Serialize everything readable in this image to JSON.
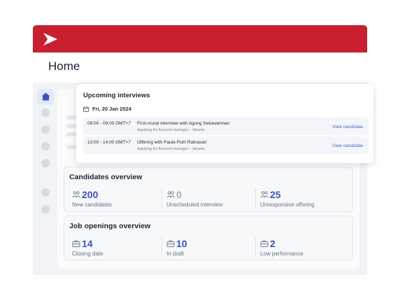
{
  "brand": {
    "bar_color": "#c8202f",
    "logo_icon": "chevron-logo"
  },
  "page": {
    "title": "Home"
  },
  "sidebar": {
    "active_icon": "home-icon",
    "accent": "#3b55b8"
  },
  "upcoming": {
    "title": "Upcoming interviews",
    "date": "Fri, 20 Jan 2024",
    "items": [
      {
        "time": "08:00 - 09:00 GMT+7",
        "title": "First-round interview with Agung Setiawarman",
        "subtitle": "Applying for Account manager - Jakarta",
        "link": "View candidate"
      },
      {
        "time": "13:00 - 14:00 GMT+7",
        "title": "Offering with Paula Putri Ratnasari",
        "subtitle": "Applying for Account manager - Jakarta",
        "link": "View candidate"
      }
    ]
  },
  "candidates": {
    "title": "Candidates overview",
    "stats": [
      {
        "value": "200",
        "label": "New candidates",
        "icon": "people-icon"
      },
      {
        "value": "0",
        "label": "Unscheduled interview",
        "icon": "people-icon"
      },
      {
        "value": "25",
        "label": "Unresponsive offering",
        "icon": "people-icon"
      }
    ]
  },
  "jobs": {
    "title": "Job openings overview",
    "stats": [
      {
        "value": "14",
        "label": "Closing date",
        "icon": "briefcase-icon"
      },
      {
        "value": "10",
        "label": "In draft",
        "icon": "briefcase-icon"
      },
      {
        "value": "2",
        "label": "Low performance",
        "icon": "briefcase-icon"
      }
    ]
  }
}
